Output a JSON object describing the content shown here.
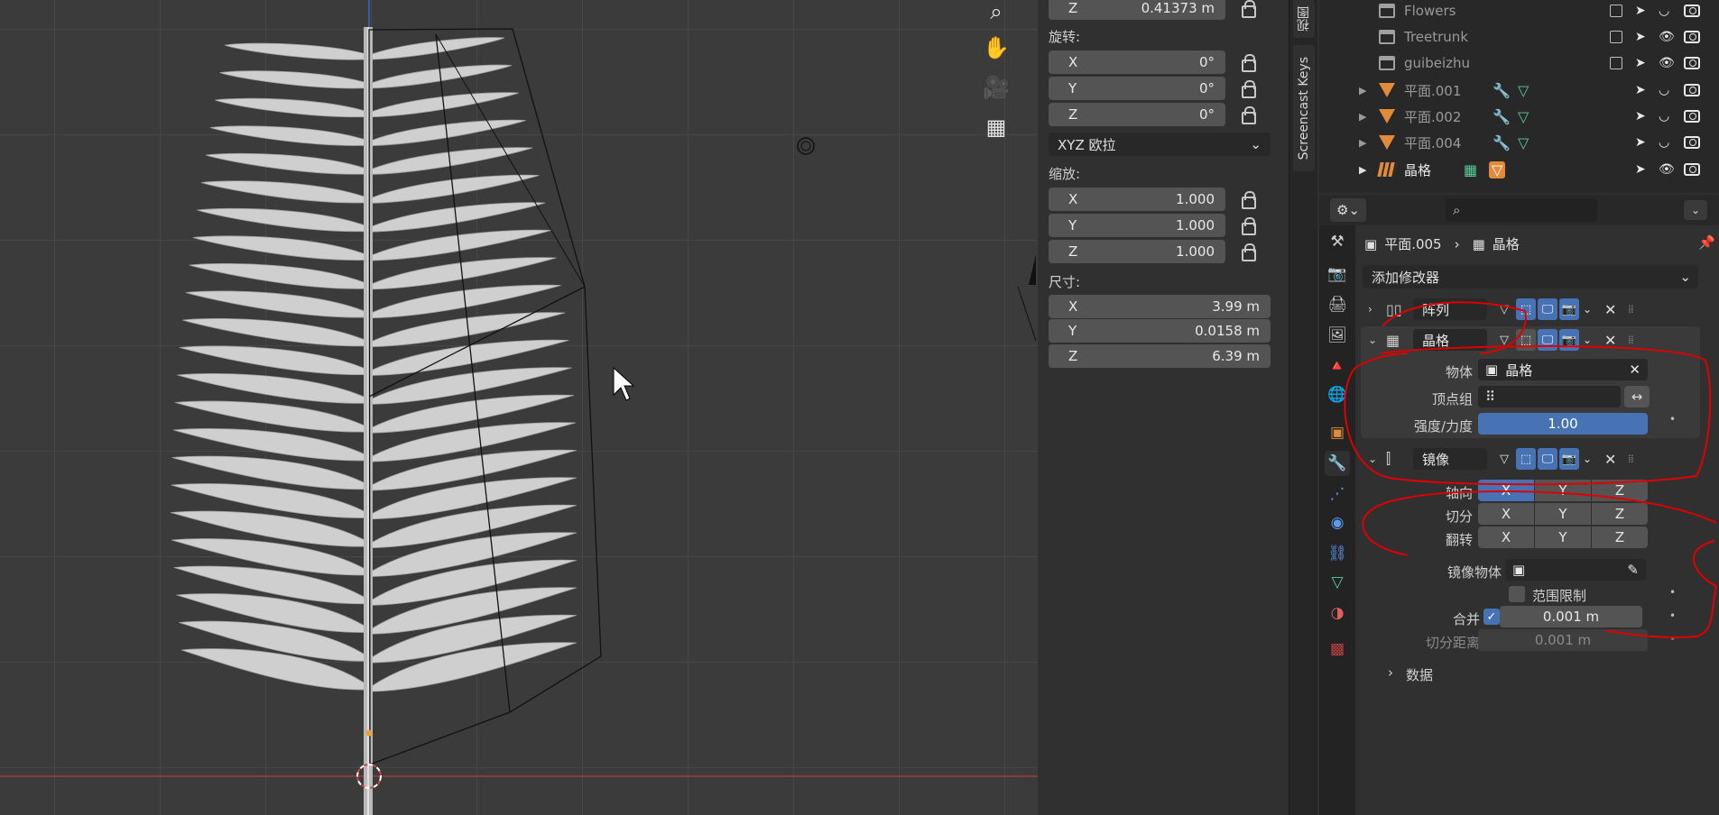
{
  "npanel": {
    "top_z": {
      "label": "Z",
      "value": "0.41373 m"
    },
    "rotation": {
      "title": "旋转:",
      "x": {
        "label": "X",
        "value": "0°"
      },
      "y": {
        "label": "Y",
        "value": "0°"
      },
      "z": {
        "label": "Z",
        "value": "0°"
      }
    },
    "rotation_mode": "XYZ 欧拉",
    "scale": {
      "title": "缩放:",
      "x": {
        "label": "X",
        "value": "1.000"
      },
      "y": {
        "label": "Y",
        "value": "1.000"
      },
      "z": {
        "label": "Z",
        "value": "1.000"
      }
    },
    "dimensions": {
      "title": "尺寸:",
      "x": {
        "label": "X",
        "value": "3.99 m"
      },
      "y": {
        "label": "Y",
        "value": "0.0158 m"
      },
      "z": {
        "label": "Z",
        "value": "6.39 m"
      }
    }
  },
  "side_tabs": {
    "view": "视图",
    "screencast": "Screencast Keys"
  },
  "outliner": {
    "rows": [
      {
        "name": "Flowers"
      },
      {
        "name": "Treetrunk"
      },
      {
        "name": "guibeizhu"
      },
      {
        "name": "平面.001"
      },
      {
        "name": "平面.002"
      },
      {
        "name": "平面.004"
      },
      {
        "name": "晶格"
      }
    ]
  },
  "properties": {
    "breadcrumb": {
      "object": "平面.005",
      "modifier": "晶格"
    },
    "add_modifier": "添加修改器",
    "modifiers": {
      "array": {
        "name": "阵列"
      },
      "lattice": {
        "name": "晶格",
        "object_label": "物体",
        "object_value": "晶格",
        "vgroup_label": "顶点组",
        "strength_label": "强度/力度",
        "strength_value": "1.00"
      },
      "mirror": {
        "name": "镜像",
        "axis_label": "轴向",
        "bisect_label": "切分",
        "flip_label": "翻转",
        "x": "X",
        "y": "Y",
        "z": "Z",
        "mirror_object_label": "镜像物体",
        "clip_label": "范围限制",
        "merge_label": "合并",
        "merge_value": "0.001 m",
        "bisect_dist_label": "切分距离",
        "bisect_dist_value": "0.001 m",
        "data_label": "数据"
      }
    }
  },
  "annotation_color": "#e00000",
  "accent_color": "#4772b3"
}
